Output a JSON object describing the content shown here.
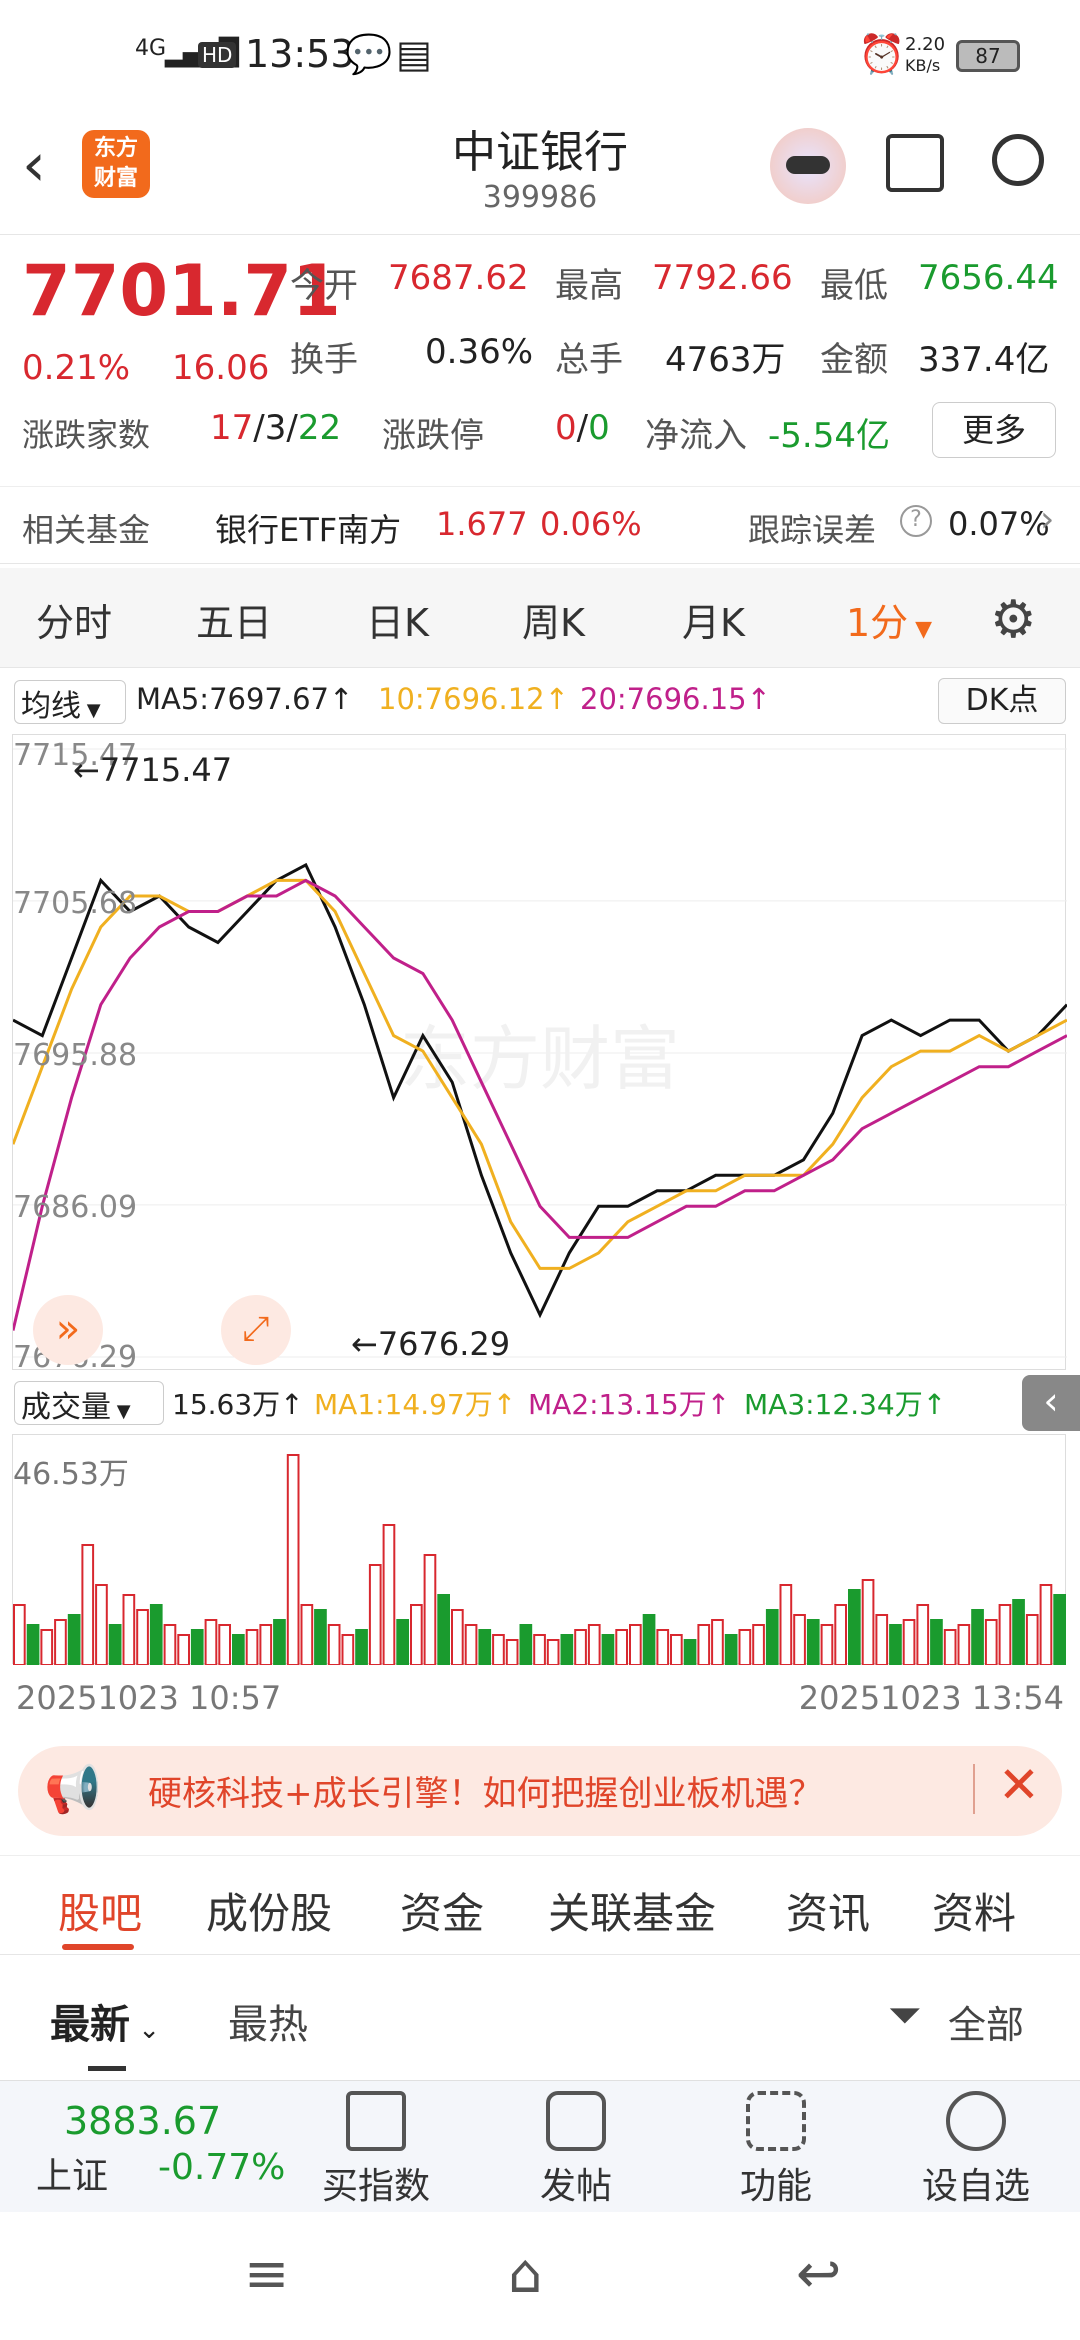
{
  "status_bar": {
    "network": "4G",
    "hd": "HD",
    "time": "13:53",
    "speed": "2.20",
    "speed_unit": "KB/s",
    "battery": "87"
  },
  "header": {
    "logo_line1": "东方",
    "logo_line2": "财富",
    "title": "中证银行",
    "code": "399986"
  },
  "quote": {
    "price": "7701.71",
    "change_pct": "0.21%",
    "change": "16.06",
    "open_label": "今开",
    "open": "7687.62",
    "high_label": "最高",
    "high": "7792.66",
    "low_label": "最低",
    "low": "7656.44",
    "turnover_label": "换手",
    "turnover": "0.36%",
    "volume_label": "总手",
    "volume": "4763万",
    "amount_label": "金额",
    "amount": "337.4亿",
    "updown_label": "涨跌家数",
    "up": "17",
    "flat": "3",
    "down": "22",
    "limit_label": "涨跌停",
    "limit_up": "0",
    "limit_down": "0",
    "netflow_label": "净流入",
    "netflow": "-5.54亿",
    "more": "更多"
  },
  "fund": {
    "label": "相关基金",
    "name": "银行ETF南方",
    "price": "1.677",
    "pct": "0.06%",
    "track_label": "跟踪误差",
    "track": "0.07%"
  },
  "period_tabs": [
    "分时",
    "五日",
    "日K",
    "周K",
    "月K",
    "1分"
  ],
  "ma": {
    "select": "均线",
    "ma5": "MA5:7697.67",
    "ma10": "10:7696.12",
    "ma20": "20:7696.15",
    "dk": "DK点"
  },
  "chart_data": {
    "type": "line",
    "title": "",
    "y_ticks": [
      "7715.47",
      "7705.68",
      "7695.88",
      "7686.09",
      "7676.29"
    ],
    "ylim": [
      7676.29,
      7715.47
    ],
    "annotations": [
      "←7715.47",
      "←7676.29"
    ],
    "x_range": [
      "20251023 10:57",
      "20251023 13:54"
    ],
    "series": [
      {
        "name": "MA5",
        "color": "#111111",
        "values": [
          7698,
          7697,
          7702,
          7707,
          7705,
          7706,
          7704,
          7703,
          7705,
          7707,
          7708,
          7704,
          7699,
          7693,
          7697,
          7694,
          7688,
          7683,
          7679,
          7683,
          7686,
          7686,
          7687,
          7687,
          7688,
          7688,
          7688,
          7689,
          7692,
          7697,
          7698,
          7697,
          7698,
          7698,
          7696,
          7697,
          7699
        ]
      },
      {
        "name": "MA10",
        "color": "#f0b020",
        "values": [
          7690,
          7695,
          7700,
          7704,
          7706,
          7706,
          7705,
          7705,
          7706,
          7707,
          7707,
          7705,
          7701,
          7697,
          7696,
          7693,
          7690,
          7685,
          7682,
          7682,
          7683,
          7685,
          7686,
          7687,
          7687,
          7688,
          7688,
          7688,
          7690,
          7693,
          7695,
          7696,
          7696,
          7697,
          7696,
          7697,
          7698
        ]
      },
      {
        "name": "MA20",
        "color": "#c0208a",
        "values": [
          7678,
          7686,
          7693,
          7699,
          7702,
          7704,
          7705,
          7705,
          7706,
          7706,
          7707,
          7706,
          7704,
          7702,
          7701,
          7698,
          7694,
          7690,
          7686,
          7684,
          7684,
          7684,
          7685,
          7686,
          7686,
          7687,
          7687,
          7688,
          7689,
          7691,
          7692,
          7693,
          7694,
          7695,
          7695,
          7696,
          7697
        ]
      }
    ]
  },
  "volume": {
    "select": "成交量",
    "current": "15.63万",
    "ma1": "MA1:14.97万",
    "ma2": "MA2:13.15万",
    "ma3": "MA3:12.34万",
    "max": "46.53万"
  },
  "ad": {
    "text": "硬核科技+成长引擎！如何把握创业板机遇？"
  },
  "bottom_tabs": [
    "股吧",
    "成份股",
    "资金",
    "关联基金",
    "资讯",
    "资料"
  ],
  "sort": {
    "latest": "最新",
    "hot": "最热",
    "filter": "全部"
  },
  "bottom_bar": {
    "index_value": "3883.67",
    "index_name": "上证",
    "index_pct": "-0.77%",
    "buy": "买指数",
    "post": "发帖",
    "func": "功能",
    "fav": "设自选"
  },
  "colors": {
    "up": "#d8282f",
    "down": "#1a9b2e",
    "accent": "#f26a1c"
  }
}
